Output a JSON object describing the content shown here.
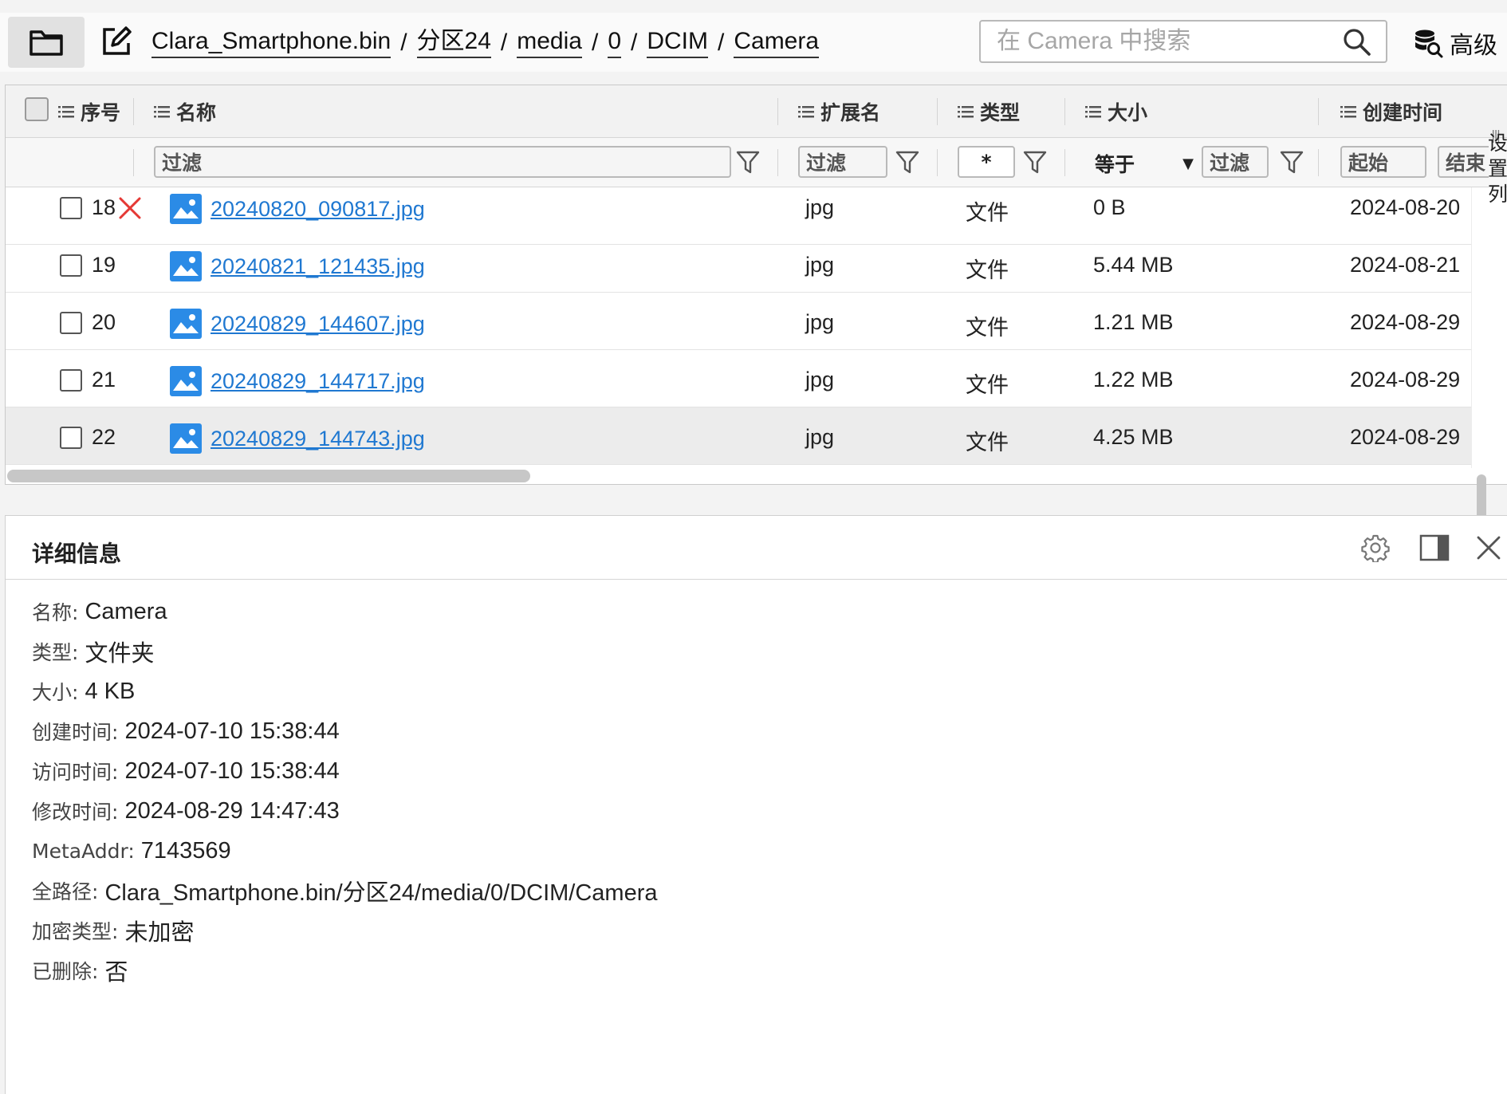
{
  "toolbar": {
    "breadcrumb": [
      "Clara_Smartphone.bin",
      "分区24",
      "media",
      "0",
      "DCIM",
      "Camera"
    ],
    "search_placeholder": "在 Camera 中搜索",
    "advanced_label": "高级"
  },
  "table": {
    "columns": {
      "index": "序号",
      "name": "名称",
      "ext": "扩展名",
      "type": "类型",
      "size": "大小",
      "ctime": "创建时间"
    },
    "filters": {
      "name": "过滤",
      "ext": "过滤",
      "type": "*",
      "size_op": "等于",
      "size": "过滤",
      "ctime_start": "起始",
      "ctime_end": "结束"
    },
    "side_settings_label": "设置列",
    "rows": [
      {
        "num": "18",
        "deleted": true,
        "name": "20240820_090817.jpg",
        "ext": "jpg",
        "type": "文件",
        "size": "0 B",
        "ctime": "2024-08-20"
      },
      {
        "num": "19",
        "deleted": false,
        "name": "20240821_121435.jpg",
        "ext": "jpg",
        "type": "文件",
        "size": "5.44 MB",
        "ctime": "2024-08-21"
      },
      {
        "num": "20",
        "deleted": false,
        "name": "20240829_144607.jpg",
        "ext": "jpg",
        "type": "文件",
        "size": "1.21 MB",
        "ctime": "2024-08-29"
      },
      {
        "num": "21",
        "deleted": false,
        "name": "20240829_144717.jpg",
        "ext": "jpg",
        "type": "文件",
        "size": "1.22 MB",
        "ctime": "2024-08-29"
      },
      {
        "num": "22",
        "deleted": false,
        "name": "20240829_144743.jpg",
        "ext": "jpg",
        "type": "文件",
        "size": "4.25 MB",
        "ctime": "2024-08-29",
        "selected": true
      }
    ]
  },
  "details": {
    "title": "详细信息",
    "props": [
      {
        "k": "名称:",
        "v": "Camera"
      },
      {
        "k": "类型:",
        "v": "文件夹"
      },
      {
        "k": "大小:",
        "v": "4 KB"
      },
      {
        "k": "创建时间:",
        "v": "2024-07-10 15:38:44"
      },
      {
        "k": "访问时间:",
        "v": "2024-07-10 15:38:44"
      },
      {
        "k": "修改时间:",
        "v": "2024-08-29 14:47:43"
      },
      {
        "k": "MetaAddr:",
        "v": "7143569"
      },
      {
        "k": "全路径:",
        "v": "Clara_Smartphone.bin/分区24/media/0/DCIM/Camera"
      },
      {
        "k": "加密类型:",
        "v": "未加密"
      },
      {
        "k": "已删除:",
        "v": "否"
      }
    ]
  },
  "colors": {
    "link": "#1f78d1",
    "deleted_mark": "#e53935",
    "image_icon": "#2b8be6"
  }
}
